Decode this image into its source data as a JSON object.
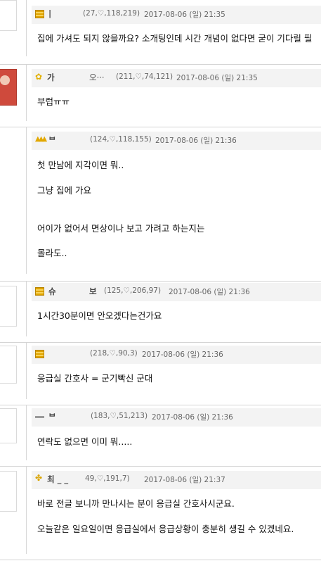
{
  "comments": [
    {
      "nick": "|",
      "stats": "(27,♡,118,219)",
      "date": "2017-08-06 (일) 21:35",
      "text": [
        "집에 가셔도 되지 않을까요? 소개팅인데 시간 개념이 없다면 굳이 기다릴 필"
      ]
    },
    {
      "nick": "가",
      "nick2": "오···",
      "stats": "(211,♡,74,121)",
      "date": "2017-08-06 (일) 21:35",
      "text": [
        "부럽ㅠㅠ"
      ]
    },
    {
      "nick": "ᄇ",
      "stats": "(124,♡,118,155)",
      "date": "2017-08-06 (일) 21:36",
      "text": [
        "첫 만남에 지각이면 뭐..",
        "그냥 집에 가요",
        "어이가 없어서 면상이나 보고 가려고 하는지는",
        "몰라도.."
      ]
    },
    {
      "nick": "슈",
      "nick2": "보",
      "stats": "(125,♡,206,97)",
      "date": "2017-08-06 (일) 21:36",
      "text": [
        "1시간30분이면 안오겠다는건가요"
      ]
    },
    {
      "nick": "",
      "stats": "(218,♡,90,3)",
      "date": "2017-08-06 (일) 21:36",
      "text": [
        "응급실 간호사 = 군기빡신 군대"
      ]
    },
    {
      "nick": "ᄇ",
      "stats": "(183,♡,51,213)",
      "date": "2017-08-06 (일) 21:36",
      "text": [
        "연락도 없으면 이미 뭐....."
      ]
    },
    {
      "nick": "최 _ _",
      "stats": "49,♡,191,7)",
      "date": "2017-08-06 (일) 21:37",
      "text": [
        "바로 전글 보니까 만나시는 분이 응급실 간호사시군요.",
        "오늘같은 일요일이면 응급실에서 응급상황이 충분히 생길 수 있겠네요."
      ]
    }
  ]
}
